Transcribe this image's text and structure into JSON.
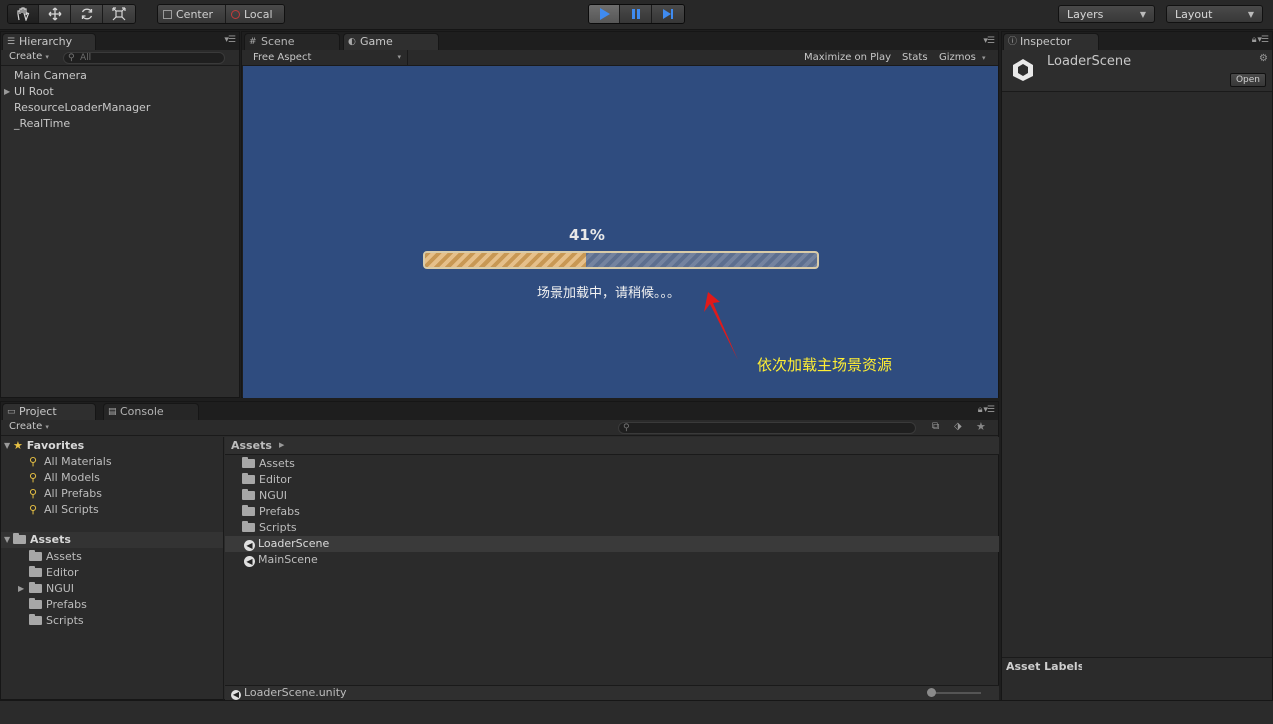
{
  "toolbar": {
    "pivot_mode": "Center",
    "pivot_rotation": "Local",
    "layers_label": "Layers",
    "layout_label": "Layout"
  },
  "hierarchy": {
    "tab_label": "Hierarchy",
    "create_label": "Create",
    "search_placeholder": "All",
    "items": [
      "Main Camera",
      "UI Root",
      "ResourceLoaderManager",
      "_RealTime"
    ]
  },
  "scene_tab": {
    "label": "Scene"
  },
  "game": {
    "tab_label": "Game",
    "aspect": "Free Aspect",
    "maximize_label": "Maximize on Play",
    "stats_label": "Stats",
    "gizmos_label": "Gizmos",
    "progress_text": "41%",
    "progress_value": 0.41,
    "loading_text": "场景加载中，请稍候。。。",
    "annotation_text": "依次加载主场景资源",
    "annotation_color": "#ffee33",
    "arrow_color": "#e01a1a",
    "background_color": "#2f4c7f"
  },
  "inspector": {
    "tab_label": "Inspector",
    "object_name": "LoaderScene",
    "open_label": "Open",
    "asset_labels": "Asset Labels"
  },
  "project": {
    "tab_label": "Project",
    "console_tab_label": "Console",
    "create_label": "Create",
    "favorites_label": "Favorites",
    "favorites": [
      "All Materials",
      "All Models",
      "All Prefabs",
      "All Scripts"
    ],
    "assets_label": "Assets",
    "tree_folders": [
      "Assets",
      "Editor",
      "NGUI",
      "Prefabs",
      "Scripts"
    ],
    "breadcrumb": "Assets",
    "content_folders": [
      "Assets",
      "Editor",
      "NGUI",
      "Prefabs",
      "Scripts"
    ],
    "content_scenes": [
      "LoaderScene",
      "MainScene"
    ],
    "selected_file": "LoaderScene.unity"
  }
}
